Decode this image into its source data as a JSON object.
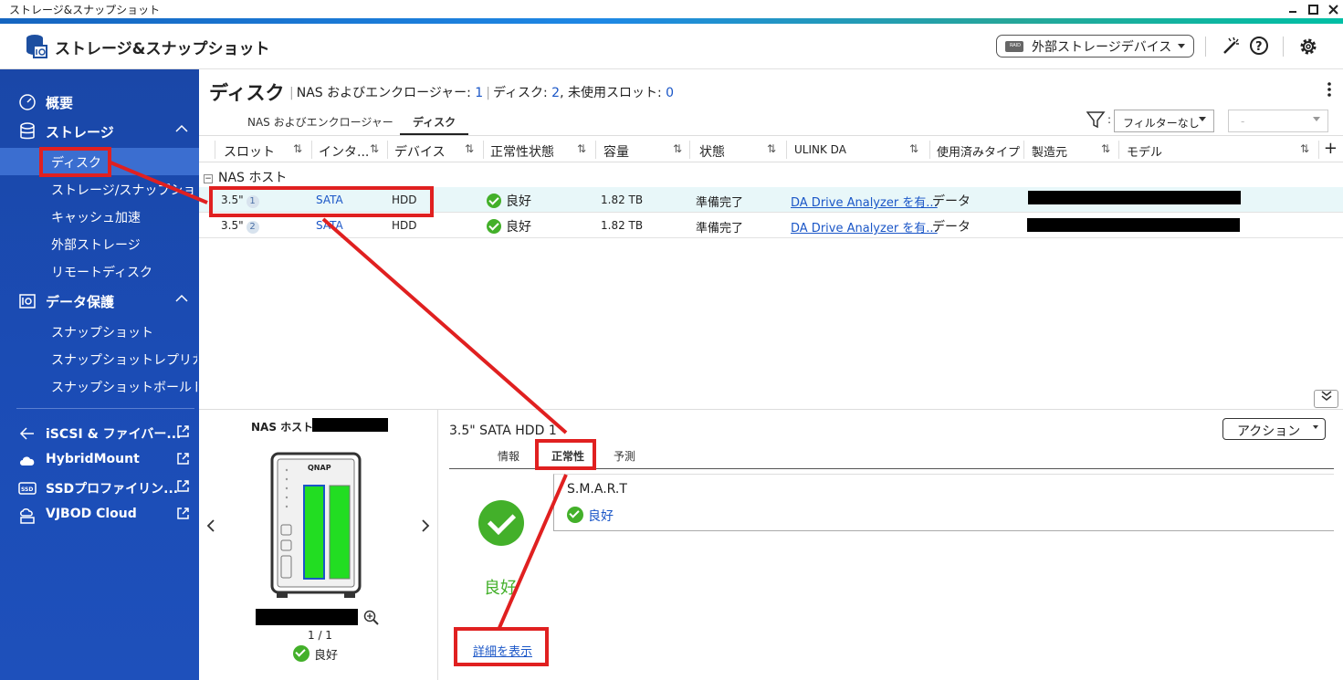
{
  "window": {
    "title": "ストレージ&スナップショット"
  },
  "header": {
    "app_title": "ストレージ&スナップショット",
    "external_button": "外部ストレージデバイス",
    "external_icon_text": "RAID"
  },
  "sidebar": {
    "overview": "概要",
    "storage": "ストレージ",
    "storage_items": [
      "ディスク",
      "ストレージ/スナップショ",
      "キャッシュ加速",
      "外部ストレージ",
      "リモートディスク"
    ],
    "protection": "データ保護",
    "protection_items": [
      "スナップショット",
      "スナップショットレプリカ",
      "スナップショットボールト"
    ],
    "links": [
      "iSCSI & ファイバー...",
      "HybridMount",
      "SSDプロファイリン...",
      "VJBOD Cloud"
    ],
    "ssd_icon_text": "SSD"
  },
  "page": {
    "title": "ディスク",
    "meta_label1": "NAS およびエンクロージャー:",
    "meta_val1": "1",
    "meta_label2": "ディスク:",
    "meta_val2": "2",
    "meta_label3": ", 未使用スロット:",
    "meta_val3": "0"
  },
  "tabs": [
    "NAS およびエンクロージャー",
    "ディスク"
  ],
  "filter": {
    "colon": ":",
    "selected": "フィルターなし",
    "second": "-"
  },
  "table": {
    "columns": [
      "スロット",
      "インタ...",
      "デバイス",
      "正常性状態",
      "容量",
      "状態",
      "ULINK DA",
      "使用済みタイプ",
      "製造元",
      "モデル"
    ],
    "group": "NAS ホスト",
    "rows": [
      {
        "slot": "3.5\"",
        "num": "1",
        "iface": "SATA",
        "device": "HDD",
        "health": "良好",
        "capacity": "1.82 TB",
        "status": "準備完了",
        "ulink": "DA Drive Analyzer を有...",
        "type": "データ"
      },
      {
        "slot": "3.5\"",
        "num": "2",
        "iface": "SATA",
        "device": "HDD",
        "health": "良好",
        "capacity": "1.82 TB",
        "status": "準備完了",
        "ulink": "DA Drive Analyzer を有...",
        "type": "データ"
      }
    ]
  },
  "device_panel": {
    "title": "NAS ホスト",
    "brand": "QNAP",
    "pager": "1 / 1",
    "health": "良好"
  },
  "disk_panel": {
    "title": "3.5\" SATA HDD 1",
    "action": "アクション",
    "tabs": [
      "情報",
      "正常性",
      "予測"
    ],
    "smart_title": "S.M.A.R.T",
    "smart_status": "良好",
    "big_status": "良好",
    "detail_link": "詳細を表示"
  },
  "colors": {
    "accent": "#1a56c7",
    "ok": "#43b02a",
    "annotation": "#e02020",
    "sidebar": "#1b4cb5"
  }
}
